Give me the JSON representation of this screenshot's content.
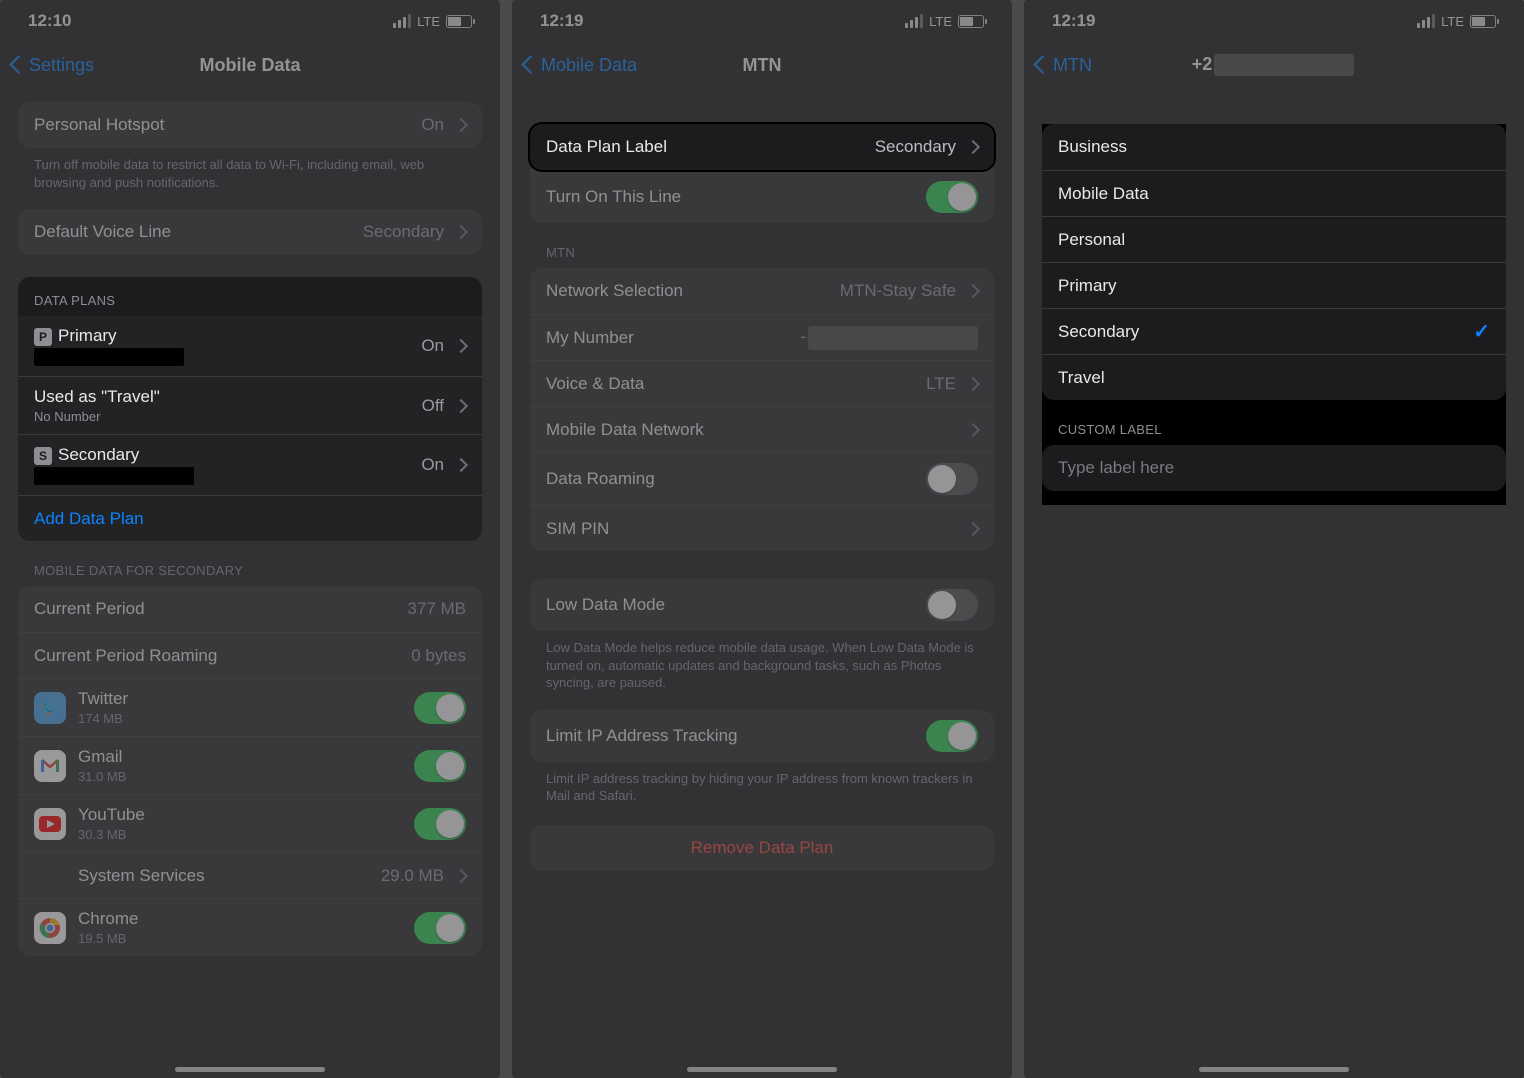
{
  "screen1": {
    "time": "12:10",
    "net_label": "LTE",
    "back_label": "Settings",
    "title": "Mobile Data",
    "personal_hotspot": {
      "label": "Personal Hotspot",
      "value": "On"
    },
    "hotspot_footnote": "Turn off mobile data to restrict all data to Wi-Fi, including email, web browsing and push notifications.",
    "default_voice": {
      "label": "Default Voice Line",
      "value": "Secondary"
    },
    "data_plans_header": "DATA PLANS",
    "plans": [
      {
        "badge": "P",
        "label": "Primary",
        "status": "On"
      },
      {
        "label": "Used as \"Travel\"",
        "sub": "No Number",
        "status": "Off"
      },
      {
        "badge": "S",
        "label": "Secondary",
        "status": "On"
      }
    ],
    "add_plan": "Add Data Plan",
    "mdfs_header": "MOBILE DATA FOR SECONDARY",
    "current_period": {
      "label": "Current Period",
      "value": "377 MB"
    },
    "current_period_roaming": {
      "label": "Current Period Roaming",
      "value": "0 bytes"
    },
    "apps": [
      {
        "name": "Twitter",
        "size": "174 MB",
        "on": true,
        "bg": "#4aa3eb",
        "glyph": "t"
      },
      {
        "name": "Gmail",
        "size": "31.0 MB",
        "on": true,
        "bg": "#ffffff",
        "glyph": "M"
      },
      {
        "name": "YouTube",
        "size": "30.3 MB",
        "on": true,
        "bg": "#ffffff",
        "glyph": "▶"
      },
      {
        "name": "System Services",
        "size": "29.0 MB"
      },
      {
        "name": "Chrome",
        "size": "19.5 MB",
        "on": true,
        "bg": "#ffffff",
        "glyph": "◉"
      }
    ]
  },
  "screen2": {
    "time": "12:19",
    "net_label": "LTE",
    "back_label": "Mobile Data",
    "title": "MTN",
    "data_plan_label": {
      "label": "Data Plan Label",
      "value": "Secondary"
    },
    "turn_on": "Turn On This Line",
    "mtn_header": "MTN",
    "rows": {
      "network_selection": {
        "label": "Network Selection",
        "value": "MTN-Stay Safe"
      },
      "my_number": {
        "label": "My Number"
      },
      "voice_data": {
        "label": "Voice & Data",
        "value": "LTE"
      },
      "mobile_data_network": {
        "label": "Mobile Data Network"
      },
      "data_roaming": {
        "label": "Data Roaming"
      },
      "sim_pin": {
        "label": "SIM PIN"
      }
    },
    "low_data": {
      "label": "Low Data Mode"
    },
    "low_data_foot": "Low Data Mode helps reduce mobile data usage. When Low Data Mode is turned on, automatic updates and background tasks, such as Photos syncing, are paused.",
    "limit_ip": {
      "label": "Limit IP Address Tracking"
    },
    "limit_ip_foot": "Limit IP address tracking by hiding your IP address from known trackers in Mail and Safari.",
    "remove": "Remove Data Plan"
  },
  "screen3": {
    "time": "12:19",
    "net_label": "LTE",
    "back_label": "MTN",
    "title_prefix": "+2",
    "labels": [
      "Business",
      "Mobile Data",
      "Personal",
      "Primary",
      "Secondary",
      "Travel"
    ],
    "selected": "Secondary",
    "custom_header": "CUSTOM LABEL",
    "placeholder": "Type label here"
  }
}
